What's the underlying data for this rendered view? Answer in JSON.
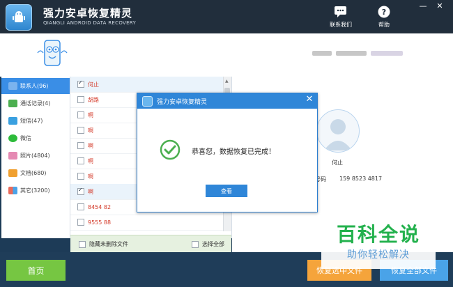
{
  "app": {
    "title": "强力安卓恢复精灵",
    "subtitle": "QIANGLI ANDROID DATA RECOVERY",
    "contact_us": "联系我们",
    "help": "帮助"
  },
  "sidebar": {
    "items": [
      {
        "label": "联系人(96)",
        "icon": "contacts-icon",
        "color": "#5b8fd6"
      },
      {
        "label": "通话记录(4)",
        "icon": "call-log-icon",
        "color": "#4caf50"
      },
      {
        "label": "短信(47)",
        "icon": "sms-icon",
        "color": "#3aa0e0"
      },
      {
        "label": "微信",
        "icon": "wechat-icon",
        "color": "#2dbb3a"
      },
      {
        "label": "照片(4804)",
        "icon": "photo-icon",
        "color": "#e58ab3"
      },
      {
        "label": "文档(680)",
        "icon": "document-icon",
        "color": "#f0a030"
      },
      {
        "label": "其它(3200)",
        "icon": "other-icon",
        "color": "#e96a5a"
      }
    ]
  },
  "list": {
    "rows": [
      {
        "name": "何止",
        "checked": true
      },
      {
        "name": "胡路",
        "checked": false
      },
      {
        "name": "啊",
        "checked": false
      },
      {
        "name": "啊",
        "checked": false
      },
      {
        "name": "啊",
        "checked": false
      },
      {
        "name": "啊",
        "checked": false
      },
      {
        "name": "啊",
        "checked": false
      },
      {
        "name": "啊",
        "checked": true
      },
      {
        "name": "8454 82",
        "checked": false
      },
      {
        "name": "9555 88",
        "checked": false
      }
    ],
    "hide_deleted_label": "隐藏未删除文件",
    "select_all_label": "选择全部"
  },
  "detail": {
    "name": "何止",
    "phone_label": "号码",
    "phone_value": "159 8523 4817"
  },
  "dialog": {
    "title": "强力安卓恢复精灵",
    "message": "恭喜您，数据恢复已完成！",
    "view_button": "查看"
  },
  "bottom": {
    "home": "首页",
    "restore_selected": "恢复选中文件",
    "restore_all": "恢复全部文件"
  },
  "watermark": {
    "title": "百科全说",
    "subtitle": "助你轻松解决"
  },
  "colors": {
    "title_bar": "#212e3c",
    "accent_blue": "#2f86d8",
    "success_green": "#4caf50"
  }
}
